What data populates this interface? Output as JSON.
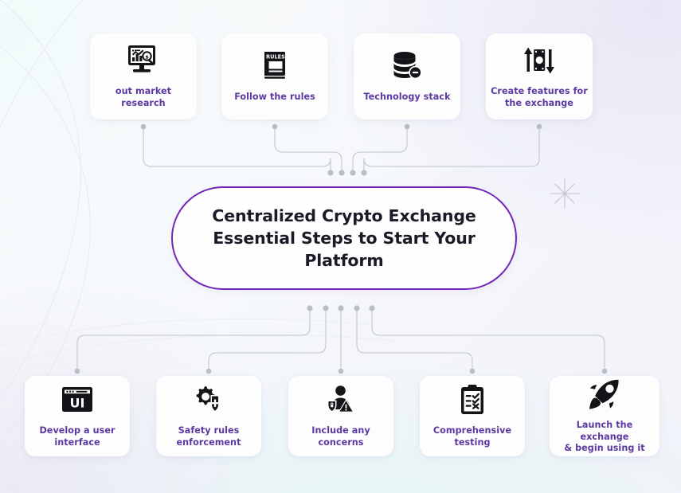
{
  "diagram": {
    "title": "Centralized Crypto Exchange Essential Steps to Start Your Platform",
    "hub": {
      "text": "Centralized Crypto Exchange\nEssential Steps to Start Your\nPlatform",
      "border_color": "#7126b5",
      "background_color": "#fefeff"
    },
    "label_color": "#5c39a0",
    "card_background": "#fdfdfe",
    "connector_color": "#c9cdd4",
    "top_steps": [
      {
        "label": "out market\nresearch",
        "icon": "market-research-monitor-icon"
      },
      {
        "label": "Follow the rules",
        "icon": "rules-book-icon"
      },
      {
        "label": "Technology stack",
        "icon": "database-stack-icon"
      },
      {
        "label": "Create features for\nthe exchange",
        "icon": "money-exchange-arrows-icon"
      }
    ],
    "bottom_steps": [
      {
        "label": "Develop a user\ninterface",
        "icon": "ui-window-icon"
      },
      {
        "label": "Safety rules\nenforcement",
        "icon": "gear-shield-icon"
      },
      {
        "label": "Include any\nconcerns",
        "icon": "user-security-warning-icon"
      },
      {
        "label": "Comprehensive\ntesting",
        "icon": "clipboard-checklist-icon"
      },
      {
        "label": "Launch the exchange\n& begin using it",
        "icon": "rocket-launch-icon"
      }
    ],
    "decoration": {
      "sparkle": "four-point-sparkle-icon"
    }
  }
}
